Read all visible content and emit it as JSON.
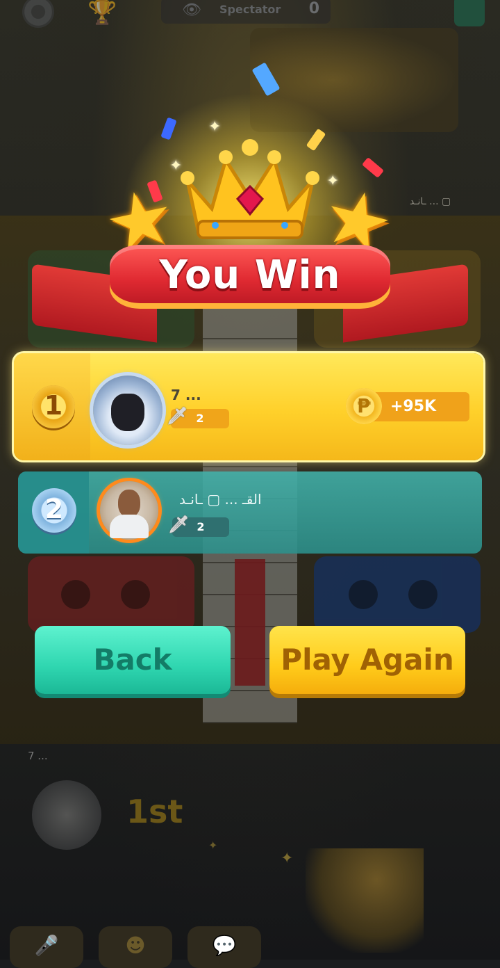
{
  "top_bar": {
    "spectator_label": "Spectator",
    "spectator_count": "0"
  },
  "banner": {
    "title": "You Win"
  },
  "results": [
    {
      "rank": "1",
      "player_name": "7 ...",
      "level": "2",
      "reward": "+95K"
    },
    {
      "rank": "2",
      "player_name": "القـ ... ▢ ـانـد",
      "level": "2"
    }
  ],
  "buttons": {
    "back_label": "Back",
    "play_again_label": "Play Again"
  },
  "background": {
    "bottom_player_name": "7 ...",
    "bottom_place": "1st",
    "side_player_name": "ـانـد ... ▢"
  },
  "colors": {
    "winner_card": "#ffd02a",
    "second_card": "#2c918c",
    "back_button": "#2fd6b0",
    "play_again_button": "#ffcb1a",
    "ribbon": "#e02a32"
  }
}
